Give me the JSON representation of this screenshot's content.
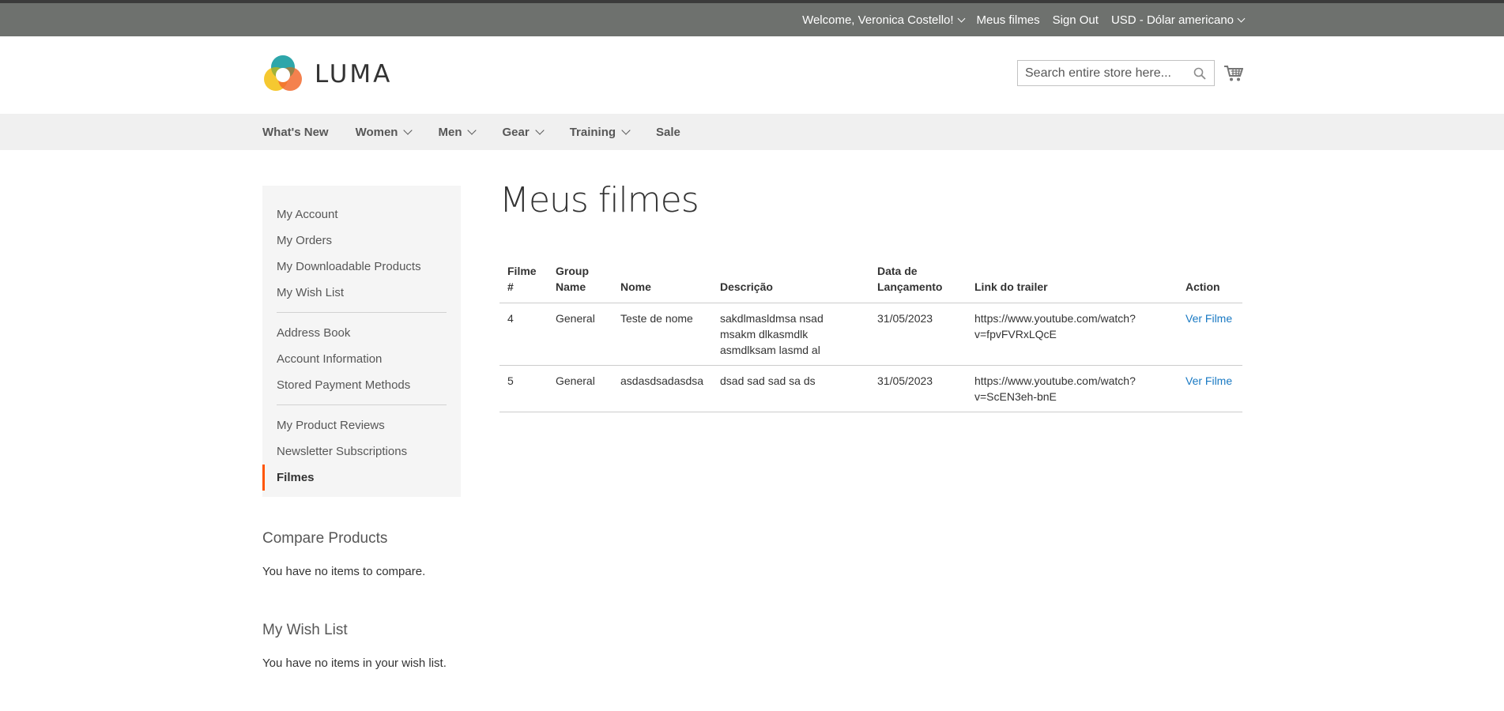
{
  "header_panel": {
    "welcome": "Welcome, Veronica Costello!",
    "my_films": "Meus filmes",
    "sign_out": "Sign Out",
    "currency": "USD - Dólar americano"
  },
  "logo": {
    "text": "LUMA"
  },
  "search": {
    "placeholder": "Search entire store here..."
  },
  "nav": {
    "items": [
      {
        "label": "What's New",
        "has_dropdown": false
      },
      {
        "label": "Women",
        "has_dropdown": true
      },
      {
        "label": "Men",
        "has_dropdown": true
      },
      {
        "label": "Gear",
        "has_dropdown": true
      },
      {
        "label": "Training",
        "has_dropdown": true
      },
      {
        "label": "Sale",
        "has_dropdown": false
      }
    ]
  },
  "sidebar": {
    "group1": [
      "My Account",
      "My Orders",
      "My Downloadable Products",
      "My Wish List"
    ],
    "group2": [
      "Address Book",
      "Account Information",
      "Stored Payment Methods"
    ],
    "group3": [
      "My Product Reviews",
      "Newsletter Subscriptions",
      "Filmes"
    ],
    "current": "Filmes"
  },
  "compare": {
    "title": "Compare Products",
    "empty": "You have no items to compare."
  },
  "wishlist": {
    "title": "My Wish List",
    "empty": "You have no items in your wish list."
  },
  "main": {
    "title": "Meus filmes",
    "table": {
      "headers": [
        "Filme #",
        "Group Name",
        "Nome",
        "Descrição",
        "Data de Lançamento",
        "Link do trailer",
        "Action"
      ],
      "rows": [
        {
          "id": "4",
          "group": "General",
          "name": "Teste de nome",
          "description": "sakdlmasldmsa nsad msakm dlkasmdlk asmdlksam lasmd al",
          "date": "31/05/2023",
          "trailer": "https://www.youtube.com/watch?v=fpvFVRxLQcE",
          "action": "Ver Filme"
        },
        {
          "id": "5",
          "group": "General",
          "name": "asdasdsadasdsa",
          "description": "dsad sad sad sa ds",
          "date": "31/05/2023",
          "trailer": "https://www.youtube.com/watch?v=ScEN3eh-bnE",
          "action": "Ver Filme"
        }
      ]
    }
  },
  "colors": {
    "header_bar": "#6e716e",
    "nav_bg": "#f0f0f0",
    "sidebar_bg": "#f5f5f5",
    "active_marker": "#ff5501",
    "link": "#1979c3"
  },
  "icons": [
    "chevron-down-icon",
    "luma-logo-icon",
    "search-icon",
    "cart-icon"
  ]
}
